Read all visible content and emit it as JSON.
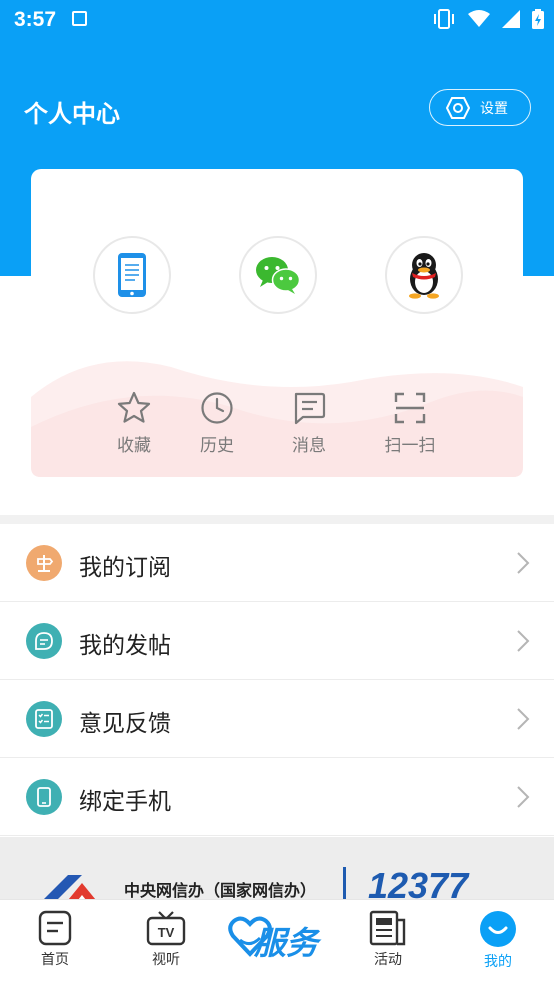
{
  "status_bar": {
    "time": "3:57"
  },
  "header": {
    "title": "个人中心",
    "settings_label": "设置"
  },
  "login_options": [
    {
      "name": "phone-login",
      "icon": "phone-icon"
    },
    {
      "name": "wechat-login",
      "icon": "wechat-icon"
    },
    {
      "name": "qq-login",
      "icon": "qq-penguin-icon"
    }
  ],
  "quick_actions": [
    {
      "label": "收藏",
      "icon": "star-icon"
    },
    {
      "label": "历史",
      "icon": "clock-icon"
    },
    {
      "label": "消息",
      "icon": "message-icon"
    },
    {
      "label": "扫一扫",
      "icon": "scan-icon"
    }
  ],
  "menu": [
    {
      "label": "我的订阅",
      "icon": "subscribe-icon",
      "color": "#f0a96f"
    },
    {
      "label": "我的发帖",
      "icon": "post-icon",
      "color": "#3fb0b3"
    },
    {
      "label": "意见反馈",
      "icon": "feedback-icon",
      "color": "#3fb0b3"
    },
    {
      "label": "绑定手机",
      "icon": "phone-bind-icon",
      "color": "#3fb0b3"
    }
  ],
  "banner": {
    "text": "中央网信办（国家网信办）",
    "number": "12377"
  },
  "tabs": [
    {
      "label": "首页",
      "icon": "home-doc-icon"
    },
    {
      "label": "视听",
      "icon": "tv-icon"
    },
    {
      "label": "服务",
      "icon": "service-heart-icon"
    },
    {
      "label": "活动",
      "icon": "newspaper-icon"
    },
    {
      "label": "我的",
      "icon": "profile-smile-icon",
      "active": true
    }
  ],
  "colors": {
    "primary": "#0aa0f6",
    "accent_orange": "#f0a96f",
    "accent_teal": "#3fb0b3"
  }
}
